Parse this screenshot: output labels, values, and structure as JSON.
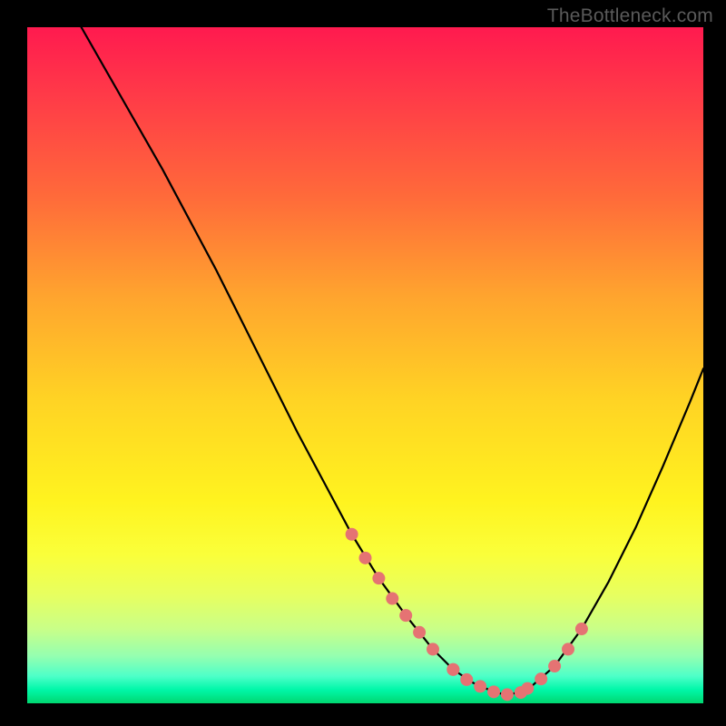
{
  "watermark": "TheBottleneck.com",
  "chart_data": {
    "type": "line",
    "title": "",
    "xlabel": "",
    "ylabel": "",
    "xlim": [
      0,
      100
    ],
    "ylim": [
      0,
      100
    ],
    "grid": false,
    "series": [
      {
        "name": "curve",
        "x": [
          8,
          12,
          16,
          20,
          24,
          28,
          32,
          36,
          40,
          44,
          48,
          52,
          56,
          60,
          63,
          66,
          69,
          71,
          74,
          78,
          82,
          86,
          90,
          94,
          98,
          100
        ],
        "values": [
          100,
          93,
          86,
          79,
          71.5,
          64,
          56,
          48,
          40,
          32.5,
          25,
          18.5,
          13,
          8,
          5,
          3,
          1.7,
          1.2,
          2,
          5.5,
          11,
          18,
          26,
          35,
          44.5,
          49.5
        ],
        "color": "#000000"
      },
      {
        "name": "highlight-left",
        "x": [
          48,
          50,
          52,
          54,
          56,
          58,
          60,
          63
        ],
        "values": [
          25,
          21.5,
          18.5,
          15.5,
          13,
          10.5,
          8,
          5
        ],
        "color": "#e57373",
        "style": "dots"
      },
      {
        "name": "highlight-bottom",
        "x": [
          63,
          65,
          67,
          69,
          71,
          73
        ],
        "values": [
          5,
          3.5,
          2.5,
          1.7,
          1.3,
          1.6
        ],
        "color": "#e57373",
        "style": "dots"
      },
      {
        "name": "highlight-right",
        "x": [
          74,
          76,
          78,
          80,
          82
        ],
        "values": [
          2.2,
          3.6,
          5.5,
          8,
          11
        ],
        "color": "#e57373",
        "style": "dots"
      }
    ]
  }
}
